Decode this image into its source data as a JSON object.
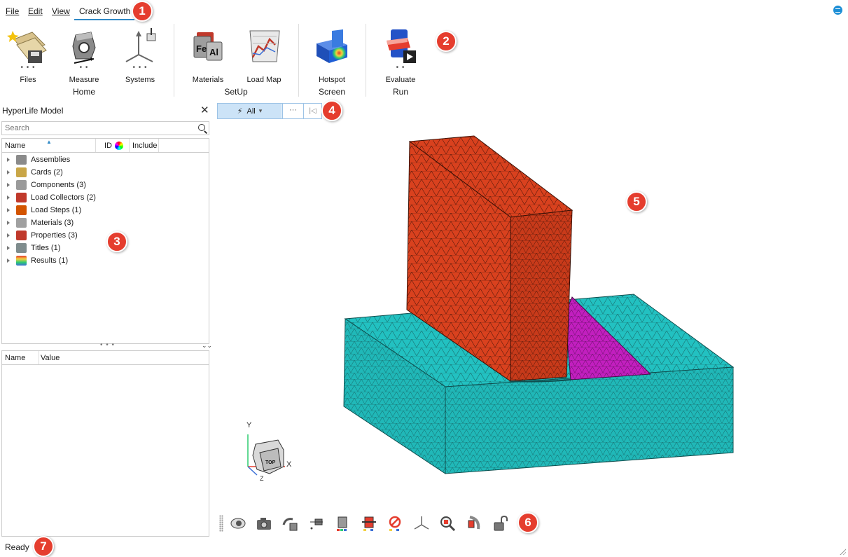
{
  "menu": {
    "file": "File",
    "edit": "Edit",
    "view": "View",
    "active_tab": "Crack Growth"
  },
  "ribbon": {
    "tools": [
      {
        "label": "Files",
        "icon": "files-icon"
      },
      {
        "label": "Measure",
        "icon": "measure-icon"
      },
      {
        "label": "Systems",
        "icon": "systems-icon"
      },
      {
        "label": "Materials",
        "icon": "materials-icon"
      },
      {
        "label": "Load Map",
        "icon": "load-map-icon"
      },
      {
        "label": "Hotspot",
        "icon": "hotspot-icon"
      },
      {
        "label": "Evaluate",
        "icon": "evaluate-icon"
      }
    ],
    "groups": [
      "Home",
      "SetUp",
      "Screen",
      "Run"
    ],
    "materials_glyphs": {
      "a": "Fe",
      "b": "Al"
    }
  },
  "callouts": [
    "1",
    "2",
    "3",
    "4",
    "5",
    "6",
    "7"
  ],
  "model_panel": {
    "title": "HyperLife Model",
    "search_placeholder": "Search",
    "columns": [
      "Name",
      "ID",
      "Include"
    ],
    "items": [
      {
        "label": "Assemblies",
        "icon": "assemblies-icon",
        "color": "#8a8a8a"
      },
      {
        "label": "Cards (2)",
        "icon": "cards-icon",
        "color": "#c9a647"
      },
      {
        "label": "Components (3)",
        "icon": "components-icon",
        "color": "#9a9a9a"
      },
      {
        "label": "Load Collectors (2)",
        "icon": "load-collectors-icon",
        "color": "#c0392b"
      },
      {
        "label": "Load Steps (1)",
        "icon": "load-steps-icon",
        "color": "#d35400"
      },
      {
        "label": "Materials (3)",
        "icon": "materials-icon",
        "color": "#a0a0a0"
      },
      {
        "label": "Properties (3)",
        "icon": "properties-icon",
        "color": "#c0392b"
      },
      {
        "label": "Titles (1)",
        "icon": "titles-icon",
        "color": "#7f8c8d"
      },
      {
        "label": "Results (1)",
        "icon": "results-icon",
        "color": "#3b6fd6"
      }
    ]
  },
  "properties_panel": {
    "columns": [
      "Name",
      "Value"
    ]
  },
  "viewport_toolbar": {
    "filter": "All",
    "more": "···"
  },
  "viewport": {
    "axis_y": "Y",
    "axis_x": "X",
    "axis_z": "Z",
    "view_cube_label": "TOP",
    "colors": {
      "upright": "#d9411e",
      "base": "#22c1c1",
      "weld": "#c21fbf",
      "mesh": "#1c1c1c"
    }
  },
  "bottom_toolbar": [
    "visualization-eye-icon",
    "capture-camera-icon",
    "rotate-icon",
    "isolate-icon",
    "color-by-icon",
    "section-icon",
    "no-entry-icon",
    "axis-icon",
    "zoom-icon",
    "cut-icon",
    "lock-icon"
  ],
  "status": {
    "text": "Ready"
  },
  "accent": "#2f89c6",
  "callout_color": "#e53d2e"
}
